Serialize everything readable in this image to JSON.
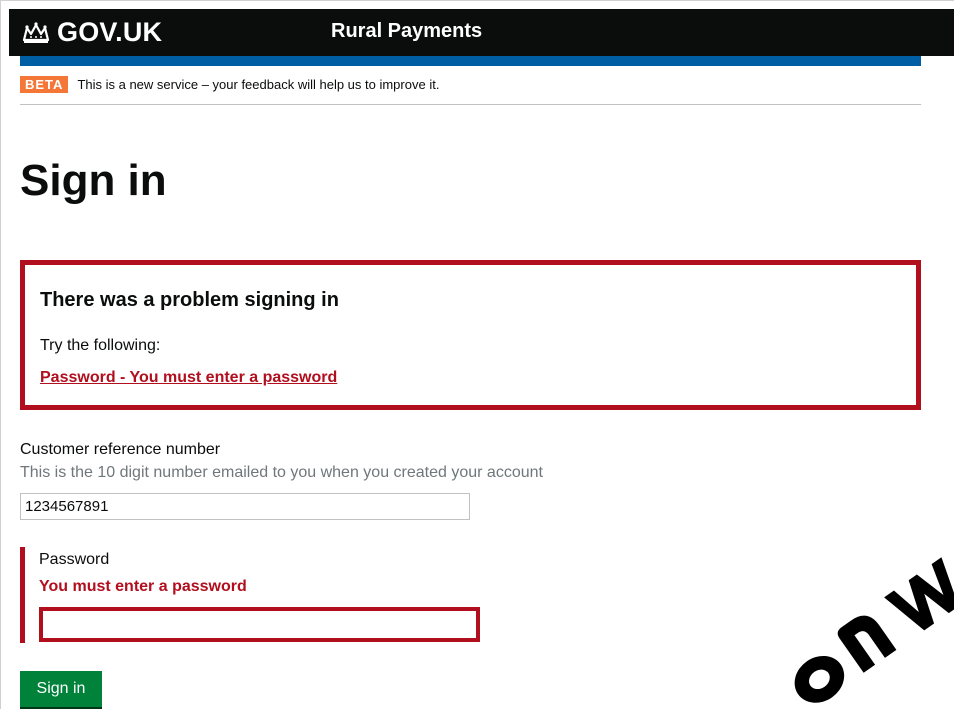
{
  "header": {
    "logo_text": "GOV.UK",
    "service_name": "Rural Payments",
    "icon": "crown-icon"
  },
  "phase_banner": {
    "tag": "BETA",
    "message": "This is a new service – your feedback will help us to improve it."
  },
  "page": {
    "title": "Sign in"
  },
  "error_summary": {
    "heading": "There was a problem signing in",
    "hint": "Try the following:",
    "errors": [
      "Password - You must enter a password"
    ]
  },
  "form": {
    "crn": {
      "label": "Customer reference number",
      "hint": "This is the 10 digit number emailed to you when you created your account",
      "value": "1234567891"
    },
    "password": {
      "label": "Password",
      "error": "You must enter a password",
      "value": ""
    },
    "submit_label": "Sign in"
  },
  "colors": {
    "header_bg": "#0b0c0c",
    "brand_blue": "#005ea5",
    "beta_orange": "#f47738",
    "error_red": "#b10e1e",
    "button_green": "#00823b"
  }
}
